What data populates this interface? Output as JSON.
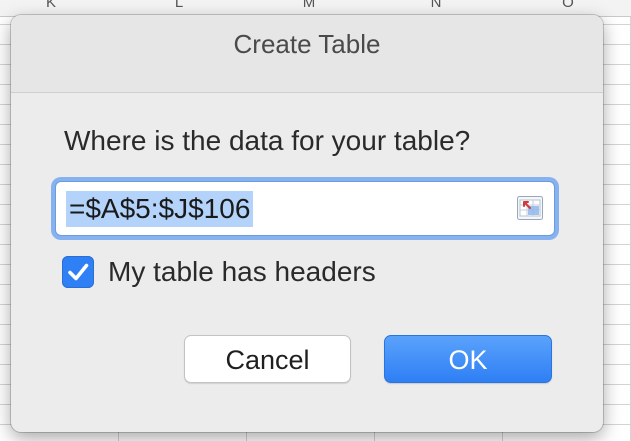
{
  "sheet": {
    "column_letters": [
      "K",
      "L",
      "M",
      "N",
      "O"
    ]
  },
  "dialog": {
    "title": "Create Table",
    "prompt": "Where is the data for your table?",
    "range_value": "=$A$5:$J$106",
    "range_selected": true,
    "collapse_icon": "range-picker-icon",
    "has_headers_label": "My table has headers",
    "has_headers_checked": true,
    "cancel_label": "Cancel",
    "ok_label": "OK",
    "accent_color": "#2f7ff5"
  }
}
